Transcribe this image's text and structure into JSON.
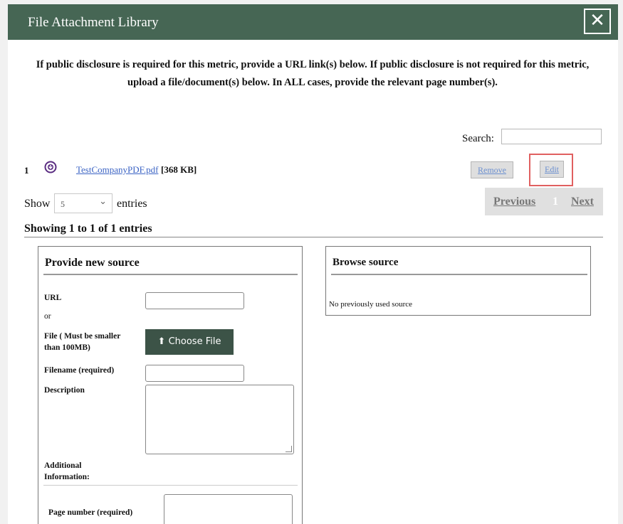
{
  "modal": {
    "title": "File Attachment Library",
    "close_glyph": "✕"
  },
  "notice": "If public disclosure is required for this metric, provide a URL link(s) below. If public disclosure is not required for this metric, upload a file/document(s) below. In ALL cases, provide the relevant page number(s).",
  "search": {
    "label": "Search:",
    "value": ""
  },
  "files": [
    {
      "index": "1",
      "name": "TestCompanyPDF.pdf",
      "size": "[368 KB]",
      "icon": "download-circle-icon",
      "remove_label": "Remove",
      "edit_label": "Edit"
    }
  ],
  "length_control": {
    "show_label": "Show",
    "value": "5",
    "entries_label": "entries"
  },
  "pagination": {
    "previous": "Previous",
    "current": "1",
    "next": "Next"
  },
  "info": "Showing 1 to 1 of 1 entries",
  "new_source": {
    "title": "Provide new source",
    "url_label": "URL",
    "or_label": "or",
    "file_label": "File ( Must be smaller than 100MB)",
    "choose_file_label": "Choose File",
    "choose_file_icon": "upload-icon",
    "filename_label": "Filename (required)",
    "description_label": "Description",
    "additional_info_label": "Additional Information:",
    "page_number_label": "Page number (required)"
  },
  "browse_source": {
    "title": "Browse source",
    "empty_text": "No previously used source"
  },
  "colors": {
    "header_bg": "#466654",
    "choose_button_bg": "#3c5347",
    "link": "#3b63c4",
    "highlight": "#e06060"
  }
}
